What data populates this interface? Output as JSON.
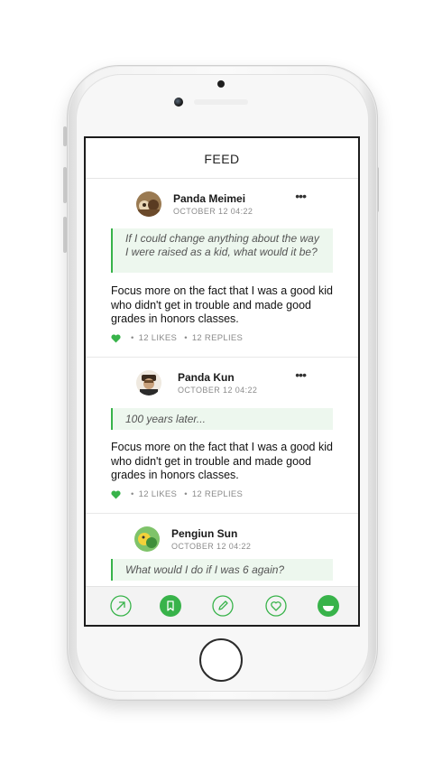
{
  "header": {
    "title": "FEED"
  },
  "posts": [
    {
      "author": "Panda Meimei",
      "date": "OCTOBER 12 04:22",
      "question": "If I could change anything about the way I were raised as a kid, what would it be?",
      "body": "Focus more on the fact that I was a good kid who didn't get in trouble and made good grades in honors classes.",
      "likes": "12 LIKES",
      "replies": "12 REPLIES"
    },
    {
      "author": "Panda Kun",
      "date": "OCTOBER 12 04:22",
      "question": "100 years later...",
      "body": "Focus more on the fact that I was a good kid who didn't get in trouble and made good grades in honors classes.",
      "likes": "12 LIKES",
      "replies": "12 REPLIES"
    },
    {
      "author": "Pengiun Sun",
      "date": "OCTOBER 12 04:22",
      "question": "What would I do if I was 6 again?"
    }
  ],
  "meta_separator": "•",
  "more_glyph": "•••",
  "tabbar": {
    "items": [
      {
        "icon": "share-arrow-icon",
        "active": false
      },
      {
        "icon": "bookmark-icon",
        "active": true
      },
      {
        "icon": "pencil-icon",
        "active": false
      },
      {
        "icon": "heart-icon",
        "active": false
      },
      {
        "icon": "smile-icon",
        "active": true
      }
    ]
  },
  "colors": {
    "accent": "#38b34a",
    "quote_bg": "#edf7ee",
    "text": "#111111",
    "muted": "#8a8a8a"
  }
}
